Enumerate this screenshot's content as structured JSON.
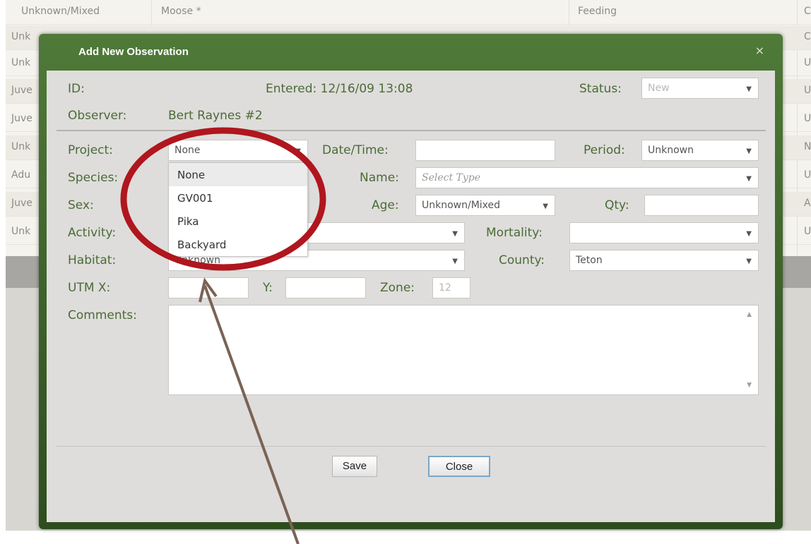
{
  "background_grid": {
    "rows": [
      {
        "col1": "Unknown/Mixed",
        "col2": "Moose *",
        "col3": "Feeding",
        "col4": "C"
      },
      {
        "col1": "Unk",
        "col4": "C"
      },
      {
        "col1": "Unk",
        "col4": "U"
      },
      {
        "col1": "Juve",
        "col4": "U"
      },
      {
        "col1": "Juve",
        "col4": "U"
      },
      {
        "col1": "Unk",
        "col4": "N"
      },
      {
        "col1": "Adu",
        "col4": "U"
      },
      {
        "col1": "Juve",
        "col4": "A"
      },
      {
        "col1": "Unk",
        "col4": "U"
      }
    ]
  },
  "dialog": {
    "title": "Add New Observation",
    "close_glyph": "×",
    "id_label": "ID:",
    "entered_text": "Entered: 12/16/09 13:08",
    "status": {
      "label": "Status:",
      "value": "New"
    },
    "observer": {
      "label": "Observer:",
      "value": "Bert Raynes #2"
    },
    "project": {
      "label": "Project:",
      "value": "None",
      "options": [
        "None",
        "GV001",
        "Pika",
        "Backyard"
      ]
    },
    "datetime": {
      "label": "Date/Time:",
      "value": ""
    },
    "period": {
      "label": "Period:",
      "value": "Unknown"
    },
    "species": {
      "label": "Species:"
    },
    "name": {
      "label": "Name:",
      "placeholder": "Select Type"
    },
    "sex": {
      "label": "Sex:"
    },
    "age": {
      "label": "Age:",
      "value": "Unknown/Mixed"
    },
    "qty": {
      "label": "Qty:",
      "value": ""
    },
    "activity": {
      "label": "Activity:",
      "value": ""
    },
    "mortality": {
      "label": "Mortality:",
      "value": ""
    },
    "habitat": {
      "label": "Habitat:",
      "value": "Unknown"
    },
    "county": {
      "label": "County:",
      "value": "Teton"
    },
    "utm_x": {
      "label": "UTM X:",
      "value": ""
    },
    "utm_y": {
      "label": "Y:",
      "value": ""
    },
    "zone": {
      "label": "Zone:",
      "value": "12"
    },
    "comments": {
      "label": "Comments:",
      "value": ""
    },
    "save_label": "Save",
    "close_label": "Close"
  },
  "colors": {
    "label_green": "#4b6b36",
    "header_green": "#4f7a38",
    "annotation_circle": "#b0161e",
    "annotation_arrow": "#7a6355"
  },
  "icons": {
    "caret": "caret-down-icon",
    "close": "close-icon"
  }
}
